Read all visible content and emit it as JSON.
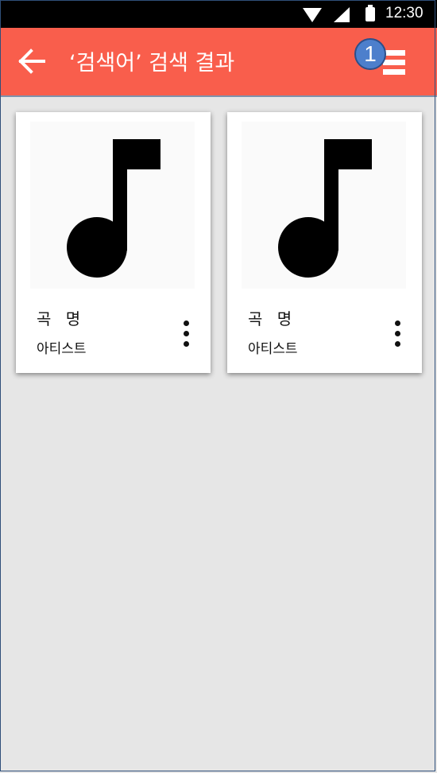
{
  "status_bar": {
    "time": "12:30",
    "icons": [
      "wifi-icon",
      "cell-signal-icon",
      "battery-icon"
    ]
  },
  "app_bar": {
    "back_icon": "arrow-left-icon",
    "title": "‘검색어’ 검색 결과",
    "menu_icon": "list-menu-icon",
    "annotation_badge": "1"
  },
  "results": [
    {
      "artwork_icon": "music-note-icon",
      "song_title": "곡 명",
      "artist": "아티스트",
      "more_icon": "more-vert-icon"
    },
    {
      "artwork_icon": "music-note-icon",
      "song_title": "곡 명",
      "artist": "아티스트",
      "more_icon": "more-vert-icon"
    }
  ],
  "colors": {
    "app_bar": "#f95e4c",
    "background": "#e6e6e6",
    "badge": "#4d7fcc"
  }
}
